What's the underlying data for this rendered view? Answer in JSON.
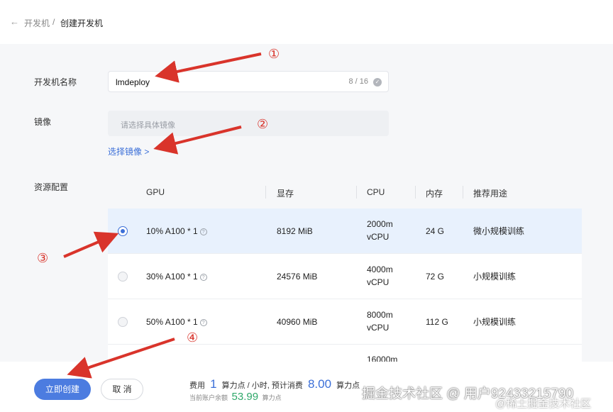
{
  "breadcrumb": {
    "parent": "开发机",
    "separator": "/",
    "current": "创建开发机"
  },
  "form": {
    "name_label": "开发机名称",
    "name_value": "lmdeploy",
    "name_count": "8 / 16",
    "image_label": "镜像",
    "image_placeholder": "请选择具体镜像",
    "choose_image_link": "选择镜像 >",
    "resource_label": "资源配置"
  },
  "table": {
    "headers": [
      "GPU",
      "显存",
      "CPU",
      "内存",
      "推荐用途"
    ],
    "rows": [
      {
        "selected": true,
        "gpu": "10% A100 * 1",
        "vram": "8192 MiB",
        "cpu_line1": "2000m",
        "cpu_line2": "vCPU",
        "memory": "24 G",
        "usage": "微小规模训练"
      },
      {
        "selected": false,
        "gpu": "30% A100 * 1",
        "vram": "24576 MiB",
        "cpu_line1": "4000m",
        "cpu_line2": "vCPU",
        "memory": "72 G",
        "usage": "小规模训练"
      },
      {
        "selected": false,
        "gpu": "50% A100 * 1",
        "vram": "40960 MiB",
        "cpu_line1": "8000m",
        "cpu_line2": "vCPU",
        "memory": "112 G",
        "usage": "小规模训练"
      },
      {
        "partial_cpu": "16000m"
      }
    ]
  },
  "footer": {
    "create_label": "立即创建",
    "cancel_label": "取 消",
    "cost_prefix": "费用",
    "cost_rate": "1",
    "cost_rate_unit": "算力点 / 小时, 预计消费",
    "cost_estimate": "8.00",
    "cost_estimate_unit": "算力点",
    "balance_prefix": "当前账户余额",
    "balance_value": "53.99",
    "balance_unit": "算力点"
  },
  "annotations": [
    "①",
    "②",
    "③",
    "④"
  ],
  "watermark": {
    "line1": "掘金技术社区 @ 用户92433215790",
    "line2": "@稀土掘金技术社区"
  },
  "colors": {
    "accent": "#3b6fd8",
    "selected_row": "#e8f1fd",
    "annotation": "#d9342b",
    "balance": "#2fa86a"
  },
  "icons": [
    "back-arrow-icon",
    "check-circle-icon",
    "radio-icon",
    "help-icon"
  ]
}
